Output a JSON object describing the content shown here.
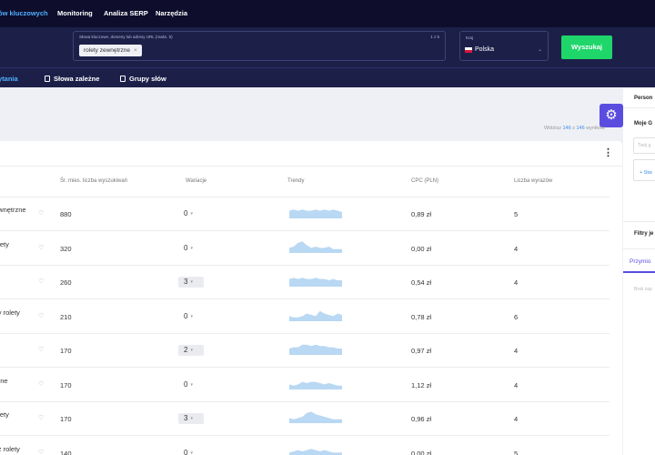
{
  "nav": {
    "items": [
      {
        "label": "ów kluczowych",
        "active": true
      },
      {
        "label": "Monitoring"
      },
      {
        "label": "Analiza SERP"
      },
      {
        "label": "Narzędzia"
      }
    ]
  },
  "search": {
    "keywords_label": "Słowa kluczowe, domeny lub adresy URL (maks. 5)",
    "keywords_count": "1 z 5",
    "chip": "rolety zewnętrzne",
    "country_label": "Kraj",
    "country": "Polska",
    "button": "Wyszukaj"
  },
  "tabs": [
    {
      "label": "ytania",
      "active": true
    },
    {
      "label": "Słowa zależne"
    },
    {
      "label": "Grupy słów"
    }
  ],
  "results": {
    "prefix": "Widzisz",
    "shown": "146",
    "sep": "z",
    "total": "146",
    "suffix": "wyników"
  },
  "table": {
    "headers": {
      "volume": "Śr. mies. liczba wyszukiwań",
      "variations": "Wariacje",
      "trends": "Trendy",
      "cpc": "CPC (PLN)",
      "words": "Liczba wyrazów"
    },
    "rows": [
      {
        "keyword": "ewnętrzne",
        "volume": "880",
        "variations": "0",
        "cpc": "0,89 zł",
        "words": "5",
        "trend": [
          6,
          7,
          6,
          7,
          6,
          6,
          7,
          6,
          7,
          6,
          7,
          6,
          5
        ],
        "badge": false
      },
      {
        "keyword": "olety",
        "volume": "320",
        "variations": "0",
        "cpc": "0,00 zł",
        "words": "4",
        "trend": [
          4,
          5,
          8,
          9,
          6,
          4,
          5,
          4,
          4,
          5,
          3,
          3,
          3
        ],
        "badge": false
      },
      {
        "keyword": "",
        "volume": "260",
        "variations": "3",
        "cpc": "0,54 zł",
        "words": "4",
        "trend": [
          6,
          7,
          6,
          7,
          6,
          6,
          7,
          6,
          6,
          5,
          6,
          5,
          5
        ],
        "badge": true
      },
      {
        "keyword": "zy rolety",
        "volume": "210",
        "variations": "0",
        "cpc": "0,78 zł",
        "words": "6",
        "trend": [
          4,
          3,
          3,
          4,
          6,
          5,
          4,
          8,
          6,
          5,
          4,
          6,
          5
        ],
        "badge": false
      },
      {
        "keyword": "ty",
        "volume": "170",
        "variations": "2",
        "cpc": "0,97 zł",
        "words": "4",
        "trend": [
          5,
          6,
          6,
          8,
          8,
          7,
          8,
          7,
          7,
          6,
          6,
          5,
          5
        ],
        "badge": true
      },
      {
        "keyword": "rzne",
        "volume": "170",
        "variations": "0",
        "cpc": "1,12 zł",
        "words": "4",
        "trend": [
          4,
          3,
          4,
          6,
          5,
          6,
          6,
          5,
          4,
          5,
          4,
          3,
          3
        ],
        "badge": false
      },
      {
        "keyword": "olety",
        "volume": "170",
        "variations": "3",
        "cpc": "0,96 zł",
        "words": "4",
        "trend": [
          4,
          3,
          4,
          5,
          8,
          9,
          7,
          6,
          5,
          4,
          3,
          3,
          3
        ],
        "badge": true
      },
      {
        "keyword": "cz rolety",
        "volume": "140",
        "variations": "0",
        "cpc": "0,00 zł",
        "words": "5",
        "trend": [
          4,
          5,
          6,
          5,
          6,
          7,
          6,
          5,
          6,
          5,
          4,
          4,
          4
        ],
        "badge": false
      }
    ]
  },
  "sidebar": {
    "title1": "Person",
    "title2": "Moje G",
    "input_placeholder": "Twój g",
    "add": "+ Stw",
    "filters": "Filtry je",
    "tab": "Przymio",
    "empty": "Brak zap"
  }
}
